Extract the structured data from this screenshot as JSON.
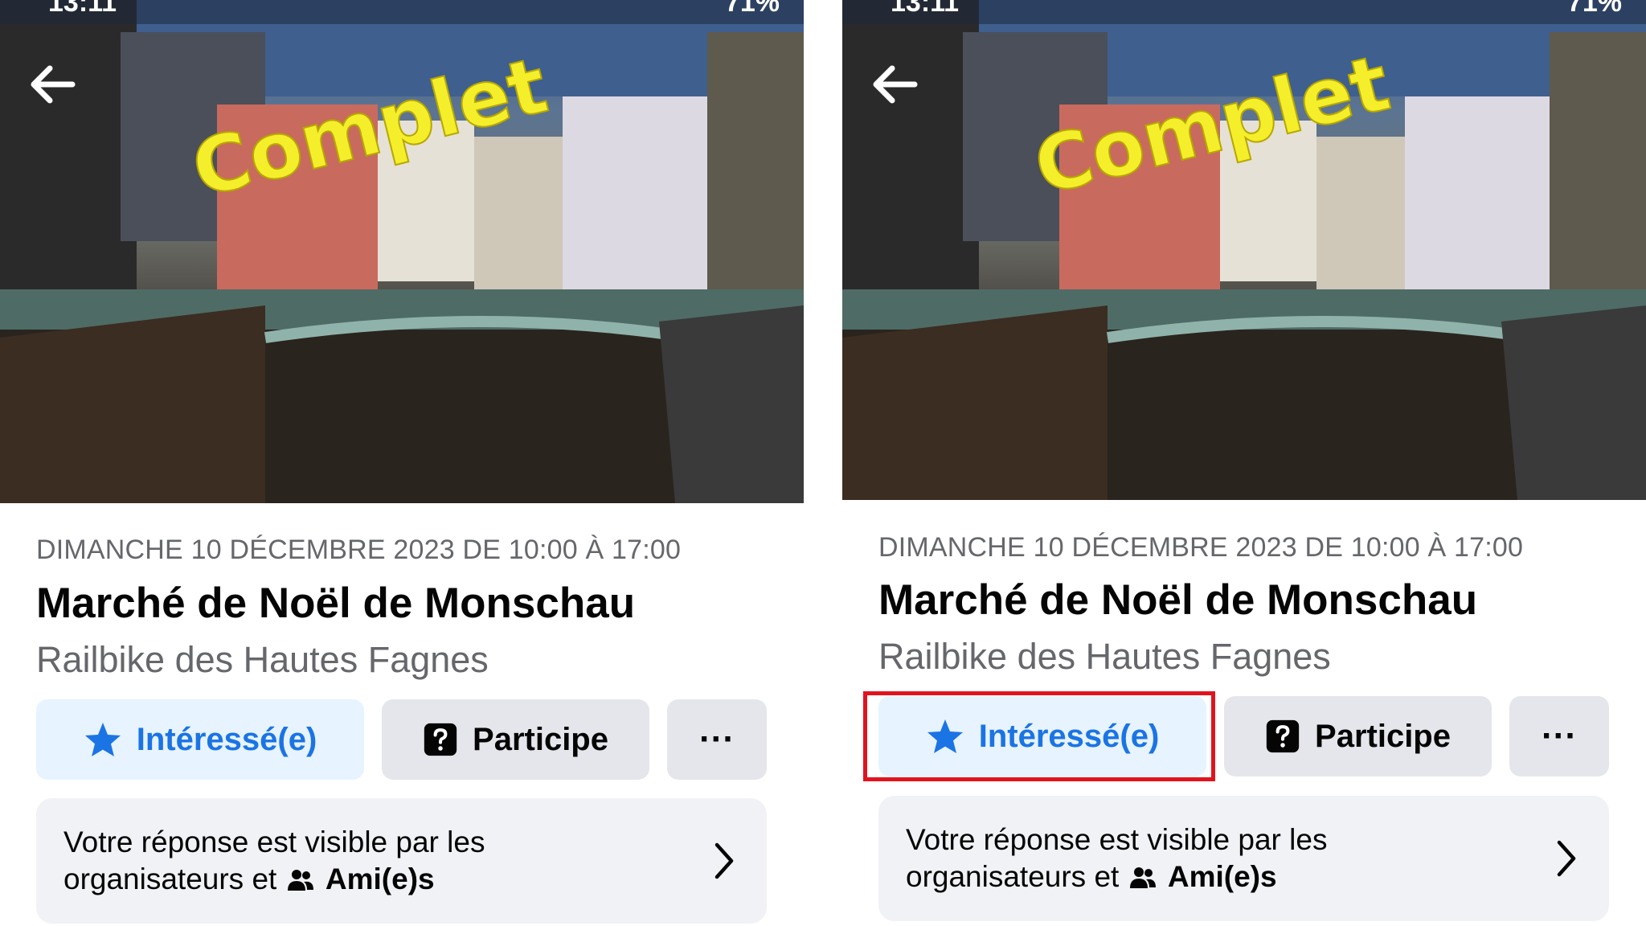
{
  "statusbar": {
    "time": "13:11",
    "battery": "71%"
  },
  "event": {
    "overlay_text": "Complet",
    "datetime": "DIMANCHE 10 DÉCEMBRE 2023 DE 10:00 À 17:00",
    "title": "Marché de Noël de Monschau",
    "organizer": "Railbike des Hautes Fagnes"
  },
  "actions": {
    "interested_label": "Intéressé(e)",
    "going_label": "Participe",
    "more_label": "···"
  },
  "visibility": {
    "line1": "Votre réponse est visible par les",
    "line2_prefix": "organisateurs et",
    "audience": "Ami(e)s"
  },
  "colors": {
    "accent": "#1b74e4",
    "interested_bg": "#e7f3ff",
    "secondary_bg": "#e4e6eb",
    "card_bg": "#f0f2f5",
    "highlight": "#e0141e",
    "overlay_text": "#f4ef2a"
  },
  "icons": [
    "back-arrow-icon",
    "star-icon",
    "question-icon",
    "more-icon",
    "chevron-right-icon",
    "friends-icon"
  ]
}
